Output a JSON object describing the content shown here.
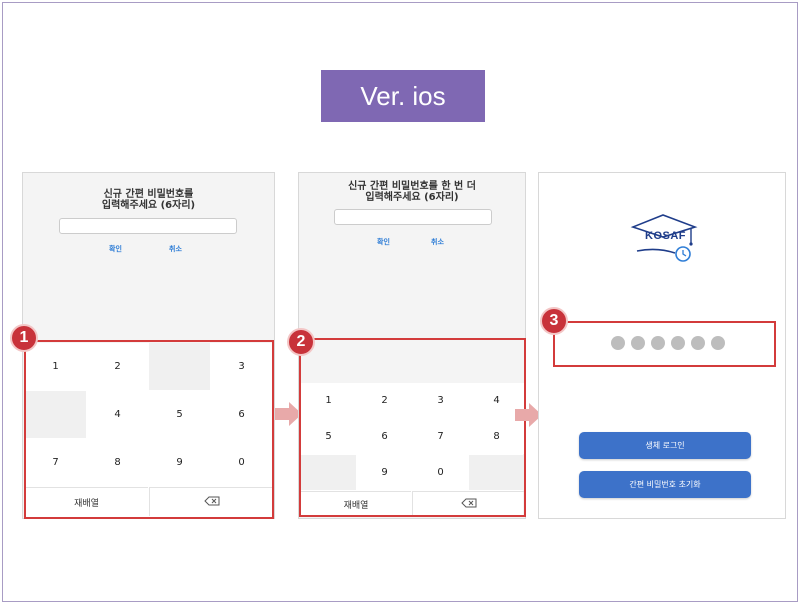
{
  "title": "Ver. ios",
  "steps": {
    "step1": "1",
    "step2": "2",
    "step3": "3"
  },
  "screen1": {
    "prompt_line1": "신규 간편 비밀번호를",
    "prompt_line2": "입력해주세요 (6자리)",
    "confirm": "확인",
    "cancel": "취소",
    "keys": [
      "1",
      "2",
      "",
      "3",
      "",
      "4",
      "5",
      "6",
      "7",
      "8",
      "9",
      "0"
    ],
    "shuffle": "재배열",
    "delete_icon": "backspace-icon"
  },
  "screen2": {
    "prompt_line1": "신규 간편 비밀번호를 한 번 더",
    "prompt_line2": "입력해주세요 (6자리)",
    "confirm": "확인",
    "cancel": "취소",
    "keys": [
      "1",
      "2",
      "3",
      "4",
      "5",
      "6",
      "7",
      "8",
      "",
      "9",
      "0",
      ""
    ],
    "shuffle": "재배열",
    "delete_icon": "backspace-icon"
  },
  "screen3": {
    "logo": "KOSAF",
    "pin_dots": 6,
    "bio_login": "생체 로그인",
    "reset_pw": "간편 비밀번호 초기화"
  },
  "colors": {
    "title_bg": "#7f68b3",
    "highlight": "#d33b3b",
    "badge": "#c8323a",
    "link_blue": "#2e7dd6",
    "button_blue": "#3d72c9",
    "arrow": "#e8a9a9"
  }
}
